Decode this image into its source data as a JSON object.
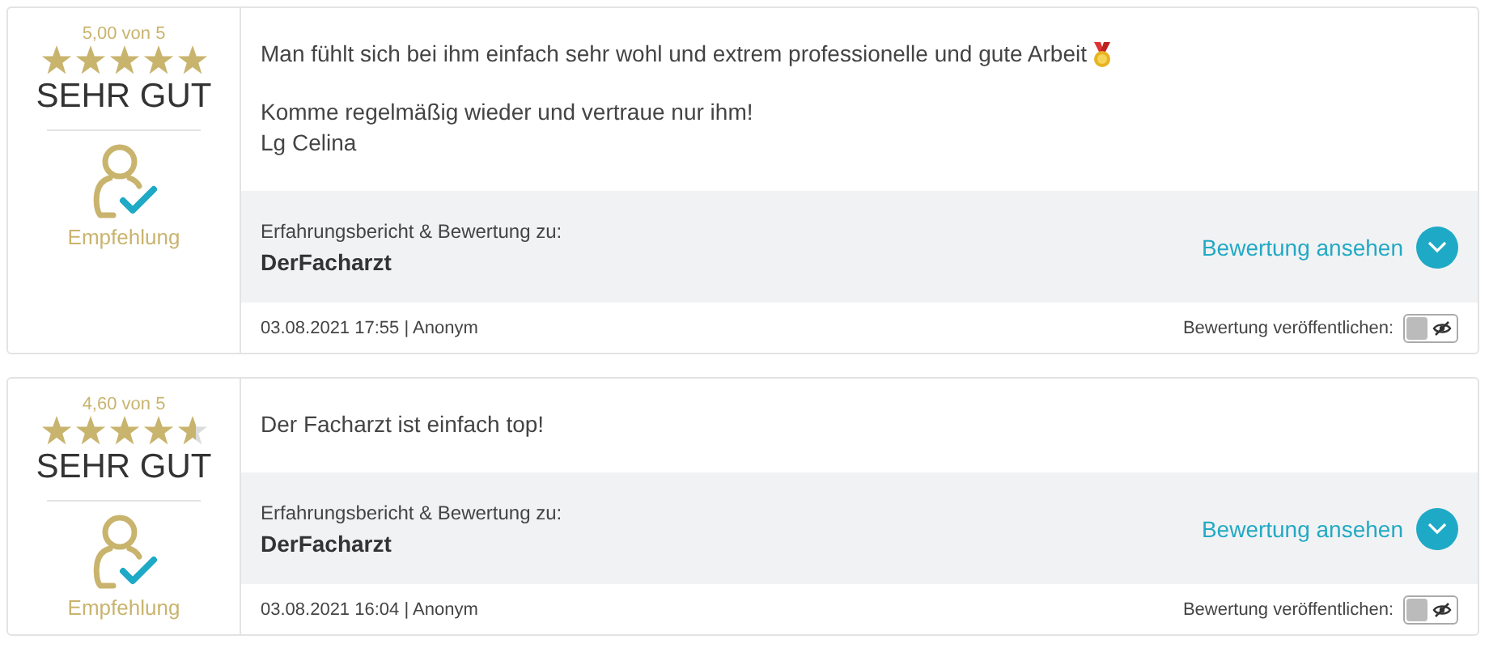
{
  "reviews": [
    {
      "rating": {
        "score": "5,00 von 5",
        "stars": 5,
        "verdict": "SEHR GUT"
      },
      "badge": {
        "label": "Empfehlung"
      },
      "paragraphs": [
        {
          "lines": [
            "Man fühlt sich bei ihm einfach sehr wohl und extrem professionelle und gute Arbeit"
          ],
          "medal": true
        },
        {
          "lines": [
            "Komme regelmäßig wieder und vertraue nur ihm!",
            "Lg Celina"
          ]
        }
      ],
      "subject": {
        "caption": "Erfahrungsbericht & Bewertung zu:",
        "name": "DerFacharzt",
        "link": "Bewertung ansehen"
      },
      "meta": "03.08.2021 17:55 | Anonym",
      "publish": {
        "label": "Bewertung veröffentlichen:",
        "on": false
      }
    },
    {
      "rating": {
        "score": "4,60 von 5",
        "stars": 4.6,
        "verdict": "SEHR GUT"
      },
      "badge": {
        "label": "Empfehlung"
      },
      "paragraphs": [
        {
          "lines": [
            "Der Facharzt ist einfach top!"
          ]
        }
      ],
      "subject": {
        "caption": "Erfahrungsbericht & Bewertung zu:",
        "name": "DerFacharzt",
        "link": "Bewertung ansehen"
      },
      "meta": "03.08.2021 16:04 | Anonym",
      "publish": {
        "label": "Bewertung veröffentlichen:",
        "on": false
      }
    }
  ]
}
